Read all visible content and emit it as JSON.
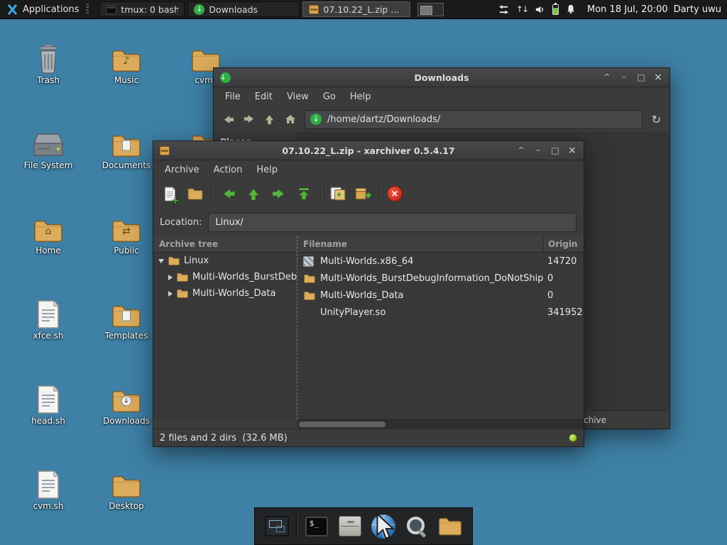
{
  "colors": {
    "desktop_bg": "#3e80a6",
    "panel_bg": "#1a1a1a",
    "window_bg": "#3b3b3b",
    "folder": "#dcac5c",
    "accent_green": "#55b33a",
    "accent_red": "#d32f24"
  },
  "top_panel": {
    "applications_label": "Applications",
    "tasks": [
      {
        "label": "tmux: 0 bash",
        "icon": "terminal-icon"
      },
      {
        "label": "Downloads",
        "icon": "file-manager-icon"
      },
      {
        "label": "07.10.22_L.zip ...",
        "icon": "xarchiver-icon"
      }
    ],
    "tray_icons": [
      "network-traffic-icon",
      "updown-arrows-icon",
      "volume-icon",
      "battery-icon",
      "notifications-bell-icon"
    ],
    "clock": "Mon 18 Jul, 20:00",
    "user_label": "Darty uwu"
  },
  "desktop": {
    "icons": [
      {
        "label": "Trash",
        "icon": "trash"
      },
      {
        "label": "Music",
        "icon": "folder-music"
      },
      {
        "label": "cvm_",
        "icon": "folder"
      },
      {
        "label": "File System",
        "icon": "drive"
      },
      {
        "label": "Documents",
        "icon": "folder-documents"
      },
      {
        "label": "Home",
        "icon": "folder-home"
      },
      {
        "label": "Public",
        "icon": "folder-public"
      },
      {
        "label": "xfce.sh",
        "icon": "script-file"
      },
      {
        "label": "Templates",
        "icon": "folder-templates"
      },
      {
        "label": "head.sh",
        "icon": "script-file"
      },
      {
        "label": "Downloads",
        "icon": "folder-downloads"
      },
      {
        "label": "cvm.sh",
        "icon": "script-file"
      },
      {
        "label": "Desktop",
        "icon": "folder"
      }
    ]
  },
  "downloads_window": {
    "title": "Downloads",
    "menu": [
      "File",
      "Edit",
      "View",
      "Go",
      "Help"
    ],
    "path": "/home/dartz/Downloads/",
    "places_header": "Places",
    "status_text": "chive"
  },
  "xarchiver_window": {
    "title": "07.10.22_L.zip - xarchiver 0.5.4.17",
    "menu": [
      "Archive",
      "Action",
      "Help"
    ],
    "location_label": "Location:",
    "location_value": "Linux/",
    "tree_header": "Archive tree",
    "columns": [
      "Filename",
      "Origin"
    ],
    "tree_root": "Linux",
    "tree_children": [
      "Multi-Worlds_BurstDebugInformation_DoNotShip",
      "Multi-Worlds_Data"
    ],
    "files": [
      {
        "name": "Multi-Worlds.x86_64",
        "size": "14720",
        "icon": "executable"
      },
      {
        "name": "Multi-Worlds_BurstDebugInformation_DoNotShip",
        "size": "0",
        "icon": "folder"
      },
      {
        "name": "Multi-Worlds_Data",
        "size": "0",
        "icon": "folder"
      },
      {
        "name": "UnityPlayer.so",
        "size": "341952",
        "icon": "none"
      }
    ],
    "statusbar": "2 files and 2 dirs  (32.6 MB)"
  },
  "dock": {
    "items": [
      "show-desktop",
      "terminal-emulator",
      "file-manager",
      "web-browser",
      "application-finder",
      "directory-menu"
    ]
  }
}
